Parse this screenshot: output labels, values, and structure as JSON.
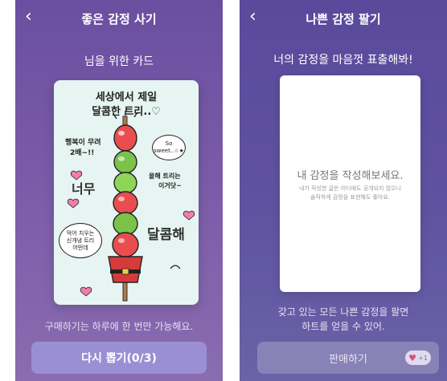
{
  "left_screen": {
    "title": "좋은 감정 사기",
    "back_icon": "‹",
    "subtitle": "님을 위한 카드",
    "card": {
      "headline_line1": "세상에서 제일",
      "headline_line2": "달콤한 트리..♡",
      "text_happy_1": "행복이 무려",
      "text_happy_2": "2배~!!",
      "bubble_sweet": "So sweet..☆★",
      "text_neomu": "너무",
      "text_winter_1": "올해 트리는",
      "text_winter_2": "이거닷~",
      "bubble_eat_1": "먹어 치우는",
      "bubble_eat_2": "신개념 트리",
      "bubble_eat_3": "어떤데",
      "text_dalkom": "달콤해"
    },
    "note": "구매하기는 하루에 한 번만 가능해요.",
    "redraw_button": "다시 뽑기(0/3)"
  },
  "right_screen": {
    "title": "나쁜 감정 팔기",
    "back_icon": "‹",
    "subtitle": "너의 감정을 마음껏 표출해봐!",
    "placeholder_main": "내 감정을 작성해보세요.",
    "placeholder_sub_1": "내가 작성한 글은 어디에도 공개되지 않으니",
    "placeholder_sub_2": "솔직하게 감정을 표현해도 좋아요.",
    "note_line1": "갖고 있는 모든 나쁜 감정을 팔면",
    "note_line2": "하트를 얻을 수 있어.",
    "sell_button": "판매하기",
    "heart_badge": "+1"
  },
  "colors": {
    "left_bg": "#6a4fa0",
    "right_bg": "#5a4a9c",
    "card_bg": "#e6f5f1",
    "primary_button": "#9b8fd3",
    "disabled_button": "#8982b7"
  }
}
